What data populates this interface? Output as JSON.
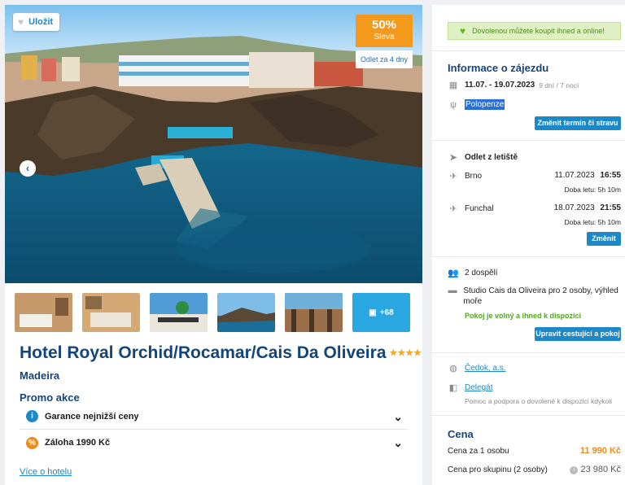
{
  "hero": {
    "save_label": "Uložit",
    "discount_pct": "50%",
    "discount_label": "Sleva",
    "departure_label": "Odlet za 4 dny",
    "prev_arrow": "‹"
  },
  "thumbs_more": "+68",
  "hotel": {
    "name": "Hotel Royal Orchid/Rocamar/Cais Da Oliveira",
    "stars": "★★★★",
    "region": "Madeira"
  },
  "promo": {
    "title": "Promo akce",
    "items": [
      {
        "label": "Garance nejnižší ceny",
        "icon": "info-icon",
        "color": "#1e88c7"
      },
      {
        "label": "Záloha 1990 Kč",
        "icon": "percent-icon",
        "color": "#f08b18"
      }
    ],
    "more_link": "Více o hotelu"
  },
  "sidebar": {
    "banner": "Dovolenou můžete koupit ihned a online!",
    "info": {
      "title": "Informace o zájezdu",
      "dates": "11.07. - 19.07.2023",
      "duration": "9 dní / 7 nocí",
      "board": "Polopenze",
      "change_button": "Změnit termín či stravu"
    },
    "flight": {
      "title": "Odlet z letiště",
      "outbound_city": "Brno",
      "outbound_date": "11.07.2023",
      "outbound_time": "16:55",
      "outbound_duration": "Doba letu: 5h 10m",
      "return_city": "Funchal",
      "return_date": "18.07.2023",
      "return_time": "21:55",
      "return_duration": "Doba letu: 5h 10m",
      "change_button": "Změnit"
    },
    "room": {
      "travellers": "2 dospělí",
      "room_name": "Studio Cais da Oliveira pro 2 osoby, výhled moře",
      "availability": "Pokoj je volný a ihned k dispozici",
      "edit_button": "Upravit cestující a pokoj"
    },
    "agency": {
      "operator": "Čedok, a.s.",
      "delegate": "Delegát",
      "delegate_note": "Pomoc a podpora o dovolené k dispozici kdykoli"
    },
    "price": {
      "title": "Cena",
      "per_person_label": "Cena za 1 osobu",
      "per_person_value": "11 990 Kč",
      "group_label": "Cena pro skupinu (2 osoby)",
      "group_value": "23 980 Kč"
    }
  },
  "colors": {
    "accent": "#1e88c7",
    "title": "#14457a",
    "discount": "#f39a1c",
    "success": "#4fa71e"
  }
}
